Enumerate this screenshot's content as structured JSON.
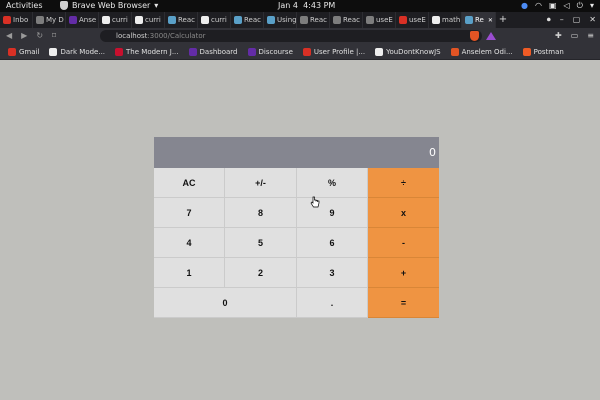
{
  "topbar": {
    "activities": "Activities",
    "app_name": "Brave Web Browser",
    "date": "Jan 4",
    "time": "4:43 PM"
  },
  "browser": {
    "tabs": [
      {
        "label": "Inbo",
        "icon": "gmail-icon",
        "color": "#d93025"
      },
      {
        "label": "My D",
        "icon": "page-icon",
        "color": "#7d7d7d"
      },
      {
        "label": "Anse",
        "icon": "devto-icon",
        "color": "#632ca6"
      },
      {
        "label": "curri",
        "icon": "github-icon",
        "color": "#eeeeee"
      },
      {
        "label": "curri",
        "icon": "github-icon",
        "color": "#eeeeee"
      },
      {
        "label": "Reac",
        "icon": "react-icon",
        "color": "#5aa0c8"
      },
      {
        "label": "curri",
        "icon": "github-icon",
        "color": "#eeeeee"
      },
      {
        "label": "Reac",
        "icon": "react-icon",
        "color": "#5aa0c8"
      },
      {
        "label": "Using",
        "icon": "react-icon",
        "color": "#5aa0c8"
      },
      {
        "label": "Reac",
        "icon": "page-icon",
        "color": "#7d7d7d"
      },
      {
        "label": "Reac",
        "icon": "page-icon",
        "color": "#7d7d7d"
      },
      {
        "label": "useE",
        "icon": "page-icon",
        "color": "#7d7d7d"
      },
      {
        "label": "useE",
        "icon": "w3-icon",
        "color": "#d93025"
      },
      {
        "label": "math",
        "icon": "github-icon",
        "color": "#eeeeee"
      },
      {
        "label": "Re",
        "icon": "react-icon",
        "color": "#5aa0c8",
        "active": true
      }
    ],
    "new_tab_label": "+",
    "url_host": "localhost",
    "url_rest": ":3000/Calculator",
    "bookmarks": [
      {
        "label": "Gmail",
        "icon": "gmail-icon",
        "color": "#d93025"
      },
      {
        "label": "Dark Mode...",
        "icon": "dark-mode-icon",
        "color": "#eeeeee"
      },
      {
        "label": "The Modern J...",
        "icon": "js-info-icon",
        "color": "#c8102e"
      },
      {
        "label": "Dashboard",
        "icon": "devto-icon",
        "color": "#632ca6"
      },
      {
        "label": "Discourse",
        "icon": "discourse-icon",
        "color": "#632ca6"
      },
      {
        "label": "User Profile |...",
        "icon": "user-profile-icon",
        "color": "#d93025"
      },
      {
        "label": "YouDontKnowJS",
        "icon": "github-icon",
        "color": "#eeeeee"
      },
      {
        "label": "Anselem Odi...",
        "icon": "anselem-icon",
        "color": "#e25424"
      },
      {
        "label": "Postman",
        "icon": "postman-icon",
        "color": "#ef5b25"
      }
    ]
  },
  "calculator": {
    "display": "0",
    "keys": {
      "ac": "AC",
      "sign": "+/-",
      "percent": "%",
      "divide": "÷",
      "seven": "7",
      "eight": "8",
      "nine": "9",
      "multiply": "x",
      "four": "4",
      "five": "5",
      "six": "6",
      "minus": "-",
      "one": "1",
      "two": "2",
      "three": "3",
      "plus": "+",
      "zero": "0",
      "decimal": ".",
      "equals": "="
    },
    "colors": {
      "display_bg": "#858690",
      "key_bg": "#e0e0e0",
      "operator_bg": "#ef9442",
      "page_bg": "#bfbfbb"
    }
  }
}
